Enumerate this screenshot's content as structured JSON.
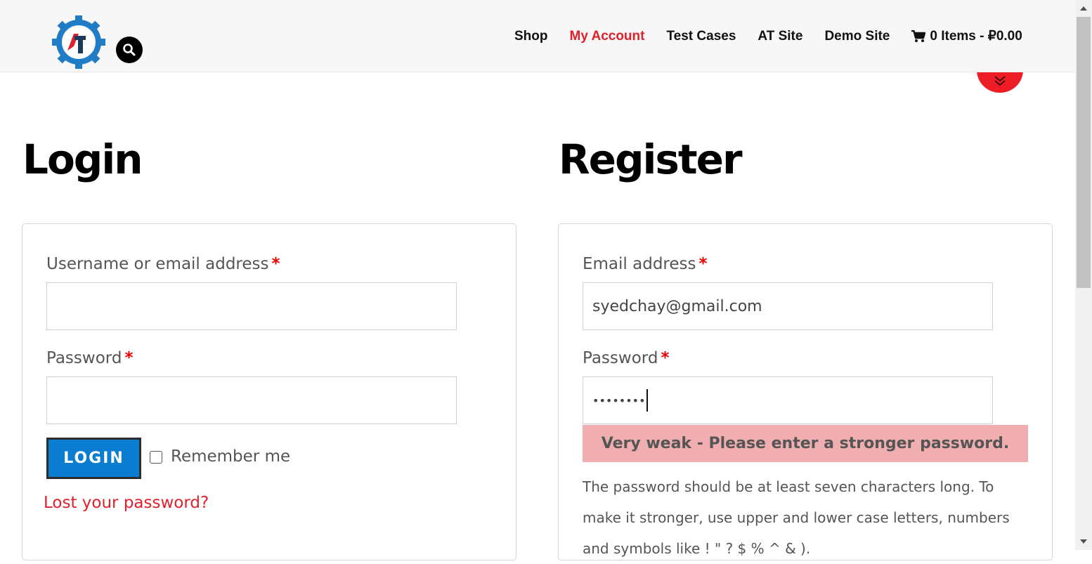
{
  "header": {
    "nav": [
      {
        "label": "Shop",
        "active": false
      },
      {
        "label": "My Account",
        "active": true
      },
      {
        "label": "Test Cases",
        "active": false
      },
      {
        "label": "AT Site",
        "active": false
      },
      {
        "label": "Demo Site",
        "active": false
      }
    ],
    "cart_label": "0 Items - ₽0.00",
    "accent_color": "#e0212b"
  },
  "login": {
    "title": "Login",
    "username_label": "Username or email address",
    "username_value": "",
    "password_label": "Password",
    "password_value": "",
    "required_mark": "*",
    "login_button": "LOGIN",
    "remember_label": "Remember me",
    "remember_checked": false,
    "lost_password": "Lost your password?"
  },
  "register": {
    "title": "Register",
    "email_label": "Email address",
    "email_value": "syedchay@gmail.com",
    "password_label": "Password",
    "password_value": "••••••••",
    "required_mark": "*",
    "strength_message": "Very weak - Please enter a stronger password.",
    "hint": "The password should be at least seven characters long. To make it stronger, use upper and lower case letters, numbers and symbols like ! \" ? $ % ^ & )."
  },
  "icons": {
    "logo": "at-gear-logo",
    "search": "search-icon",
    "cart": "cart-icon",
    "scroll_down": "double-chevron-down-icon"
  }
}
